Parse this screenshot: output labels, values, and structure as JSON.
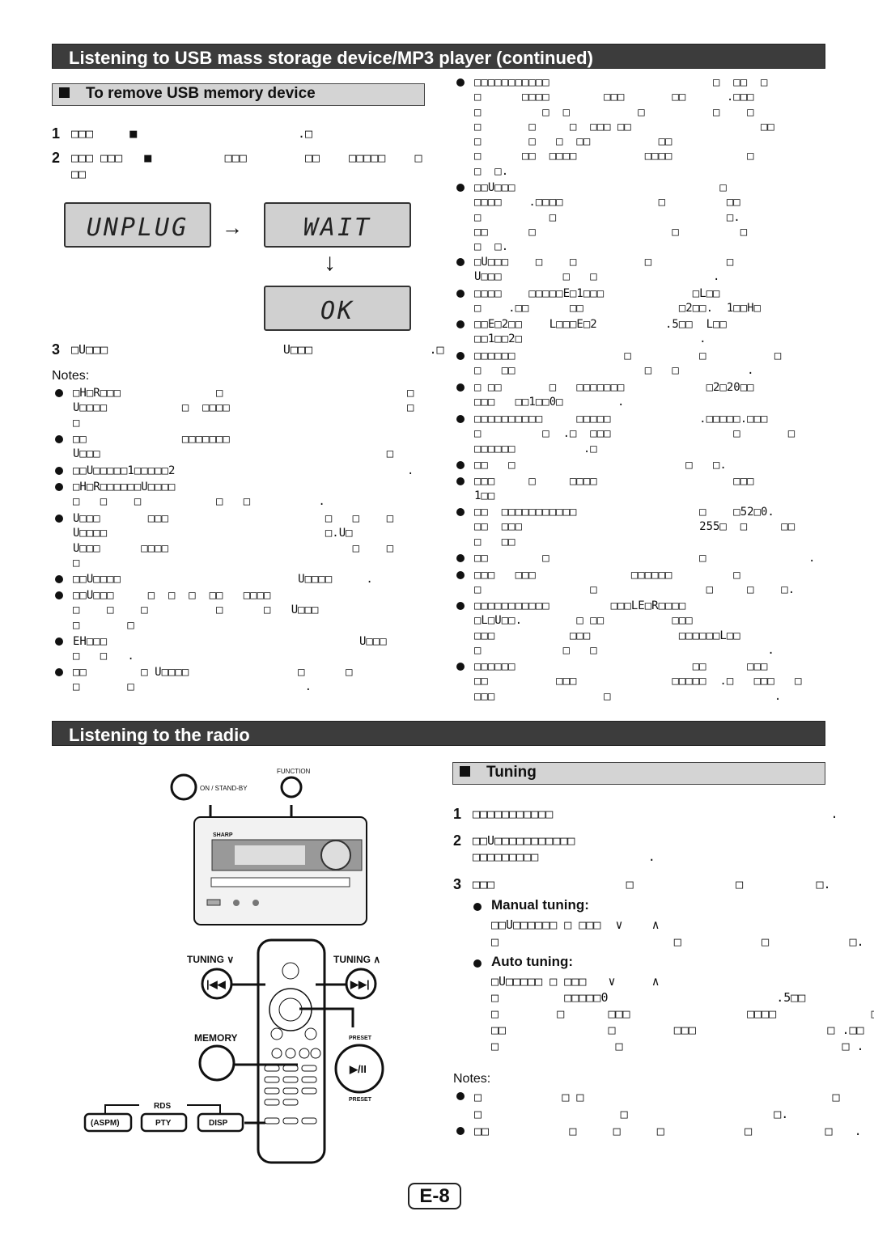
{
  "usb": {
    "title": "Listening to USB mass storage device/MP3 player (continued)",
    "remove_title": "To remove USB memory device",
    "steps": [
      {
        "n": "1",
        "lines": [
          "□□□     ■                      .□"
        ]
      },
      {
        "n": "2",
        "lines": [
          "□□□ □□□   ■          □□□        □□    □□□□□    □",
          "□□"
        ]
      },
      {
        "n": "3",
        "lines": [
          "□U□□□                        U□□□                .□"
        ]
      }
    ],
    "lcd": [
      "UNPLUG",
      "WAIT",
      "OK"
    ],
    "notes_label": "Notes:",
    "notes": [
      [
        "□H□R□□□              □                           □",
        "U□□□□           □  □□□□                          □",
        "□"
      ],
      [
        "□□              □□□□□□□",
        "U□□□                                          □"
      ],
      [
        "□□U□□□□□1□□□□□2                                  ."
      ],
      [
        "□H□R□□□□□□U□□□□",
        "□   □    □           □   □          ."
      ],
      [
        "U□□□       □□□                       □   □    □",
        "U□□□□                                □.U□",
        "U□□□      □□□□                           □    □",
        "□"
      ],
      [
        "□□U□□□□                          U□□□□     ."
      ],
      [
        "□□U□□□     □  □  □  □□   □□□□",
        "□    □    □          □      □   U□□□",
        "□       □"
      ],
      [
        "EH□□□                                     U□□□",
        "□   □   ."
      ],
      [
        "□□        □ U□□□□                □      □",
        "□       □                         ."
      ]
    ]
  },
  "right_notes": [
    [
      "□□□□□□□□□□□                        □  □□  □",
      "□      □□□□        □□□       □□      .□□□",
      "□         □  □          □          □    □",
      "□       □     □  □□□ □□                   □□",
      "□       □   □  □□          □□",
      "□      □□  □□□□          □□□□           □",
      "□  □."
    ],
    [
      "□□U□□□                              □",
      "□□□□    .□□□□              □         □□",
      "□          □                         □.",
      "□□      □                    □         □",
      "□  □."
    ],
    [
      "□U□□□    □    □          □           □",
      "U□□□         □   □                 ."
    ],
    [
      "□□□□    □□□□□E□1□□□             □L□□",
      "□    .□□      □□              □2□□.  1□□H□"
    ],
    [
      "□□E□2□□    L□□□E□2          .5□□  L□□",
      "□□1□□2□                          ."
    ],
    [
      "□□□□□□                □          □          □",
      "□   □□                   □   □          ."
    ],
    [
      "□ □□       □   □□□□□□□            □2□20□□",
      "□□□   □□1□□0□        ."
    ],
    [
      "□□□□□□□□□□     □□□□□             .□□□□□.□□□",
      "□         □  .□  □□□                  □       □",
      "□□□□□□          .□"
    ],
    [
      "□□   □                         □   □."
    ],
    [
      "□□□     □     □□□□                    □□□",
      "1□□"
    ],
    [
      "□□  □□□□□□□□□□□                  □    □52□0.",
      "□□  □□□                          255□  □     □□",
      "□   □□"
    ],
    [
      "□□        □                      □               ."
    ],
    [
      "□□□   □□□              □□□□□□         □",
      "□                □                □     □    □."
    ],
    [
      "□□□□□□□□□□□         □□□LE□R□□□□",
      "□L□U□□.        □ □□          □□□",
      "□□□           □□□             □□□□□□L□□",
      "□            □   □                         ."
    ],
    [
      "□□□□□□                          □□      □□□",
      "□□          □□□              □□□□□  .□   □□□   □",
      "□□□                □                        ."
    ]
  ],
  "radio": {
    "title": "Listening to the radio",
    "tuning_title": "Tuning",
    "steps": [
      {
        "n": "1",
        "lines": [
          "□□□□□□□□□□□                                      ."
        ]
      },
      {
        "n": "2",
        "lines": [
          "□□U□□□□□□□□□□□",
          "□□□□□□□□□               ."
        ]
      },
      {
        "n": "3",
        "lines": [
          "□□□                  □              □          □."
        ]
      }
    ],
    "manual_label": "Manual tuning:",
    "manual_lines": [
      "□□U□□□□□□ □ □□□  ∨    ∧",
      "□                        □           □           □."
    ],
    "auto_label": "Auto tuning:",
    "auto_lines": [
      "□U□□□□□ □ □□□   ∨     ∧",
      "□         □□□□□0                       .5□□",
      "□        □      □□□                □□□□             □",
      "□□              □        □□□                  □ .□□",
      "□                □                              □ ."
    ],
    "notes_label": "Notes:",
    "notes": [
      [
        "□           □ □                                  □",
        "□                   □                    □."
      ],
      [
        "□□           □     □     □           □          □   ."
      ]
    ],
    "diagram": {
      "on_standby": "ON / STAND-BY",
      "function": "FUNCTION",
      "brand": "SHARP",
      "tuning_down": "TUNING ∨",
      "tuning_up": "TUNING ∧",
      "memory": "MEMORY",
      "preset": "PRESET",
      "play_pause": "▶/II",
      "rds": "RDS",
      "aspm": "(ASPM)",
      "pty": "PTY",
      "disp": "DISP"
    }
  },
  "page_number": "E-8"
}
